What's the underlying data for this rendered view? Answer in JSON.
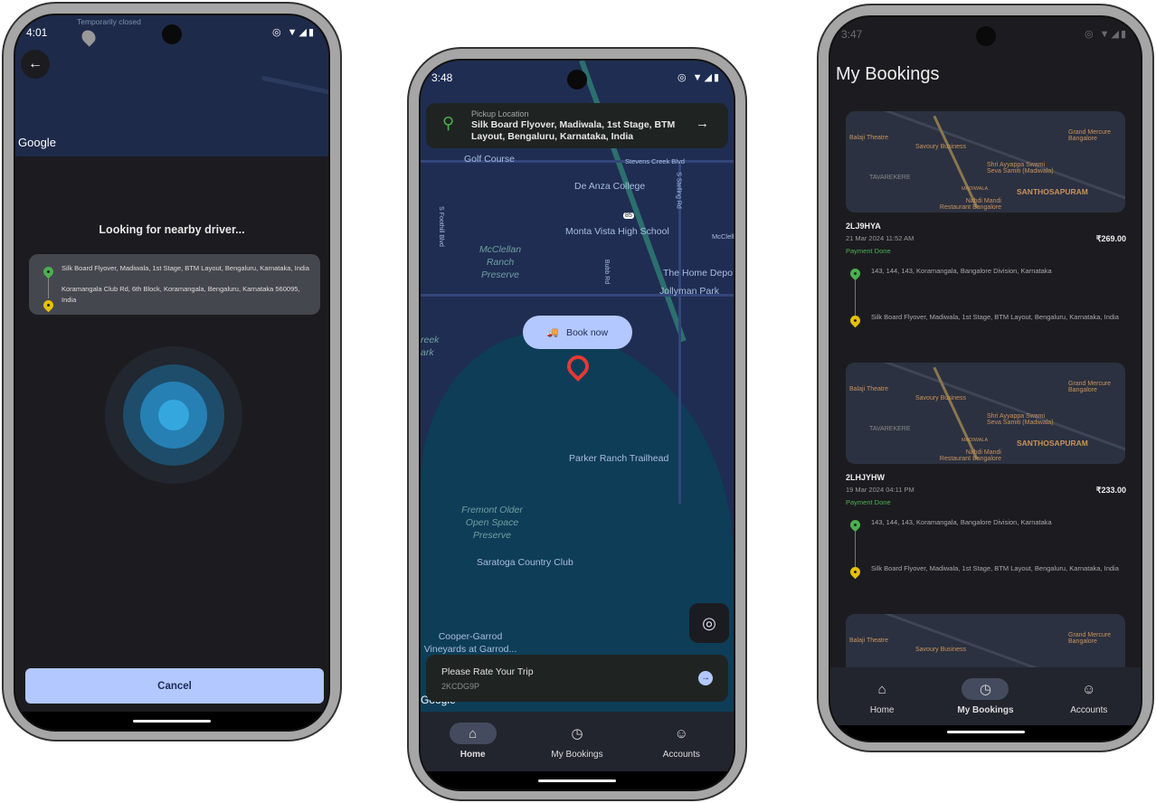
{
  "left": {
    "status_time": "4:01",
    "map_label": "Temporarily closed",
    "google": "Google",
    "heading": "Looking for nearby driver...",
    "pickup": "Silk Board Flyover, Madiwala, 1st Stage, BTM Layout, Bengaluru, Karnataka, India",
    "drop": "Koramangala Club Rd, 6th Block, Koramangala, Bengaluru, Karnataka 560095, India",
    "cancel": "Cancel"
  },
  "middle": {
    "status_time": "3:48",
    "pickup_label": "Pickup Location",
    "pickup_value": "Silk Board Flyover, Madiwala, 1st Stage, BTM Layout, Bengaluru, Karnataka, India",
    "book_now": "Book now",
    "map_labels": [
      "Golf Course",
      "Stevens Creek Blvd",
      "De Anza College",
      "Monta Vista High School",
      "McClellan Ranch Preserve",
      "The Home Depo",
      "Jollyman Park",
      "Parker Ranch Trailhead",
      "Fremont Older Open Space Preserve",
      "Saratoga Country Club",
      "Cooper-Garrod Vineyards at Garrod...",
      "S Foothill Blvd",
      "S Stelling Rd",
      "Bubb Rd",
      "85",
      "reek ark",
      "McClella"
    ],
    "rate_title": "Please Rate Your Trip",
    "rate_code": "2KCDG9P",
    "google": "Google",
    "nav": [
      {
        "label": "Home",
        "icon": "home-icon",
        "active": true
      },
      {
        "label": "My Bookings",
        "icon": "clock-icon",
        "active": false
      },
      {
        "label": "Accounts",
        "icon": "account-icon",
        "active": false
      }
    ]
  },
  "right": {
    "status_time": "3:47",
    "title": "My Bookings",
    "map_labels": [
      "Balaji Theatre",
      "Savoury Business",
      "Grand Mercure Bangalore",
      "Shri Ayyappa Swami Seva Samiti (Madiwala)",
      "TAVAREKERE",
      "MADIWALA",
      "SANTHOSAPURAM",
      "Nahdi Mandi Restaurant Bangalore"
    ],
    "bookings": [
      {
        "id": "2LJ9HYA",
        "date": "21 Mar 2024 11:52 AM",
        "price": "₹269.00",
        "status": "Payment Done",
        "from": "143, 144, 143, Koramangala, Bangalore Division, Karnataka",
        "to": "Silk Board Flyover, Madiwala, 1st Stage, BTM Layout, Bengaluru, Karnataka, India"
      },
      {
        "id": "2LHJYHW",
        "date": "19 Mar 2024 04:11 PM",
        "price": "₹233.00",
        "status": "Payment Done",
        "from": "143, 144, 143, Koramangala, Bangalore Division, Karnataka",
        "to": "Silk Board Flyover, Madiwala, 1st Stage, BTM Layout, Bengaluru, Karnataka, India"
      }
    ],
    "nav": [
      {
        "label": "Home",
        "icon": "home-icon",
        "active": false
      },
      {
        "label": "My Bookings",
        "icon": "clock-icon",
        "active": true
      },
      {
        "label": "Accounts",
        "icon": "account-icon",
        "active": false
      }
    ]
  },
  "colors": {
    "accent": "#b3c8ff",
    "green": "#4caf50",
    "yellow": "#e6c200",
    "map": "#1e2a4a"
  }
}
